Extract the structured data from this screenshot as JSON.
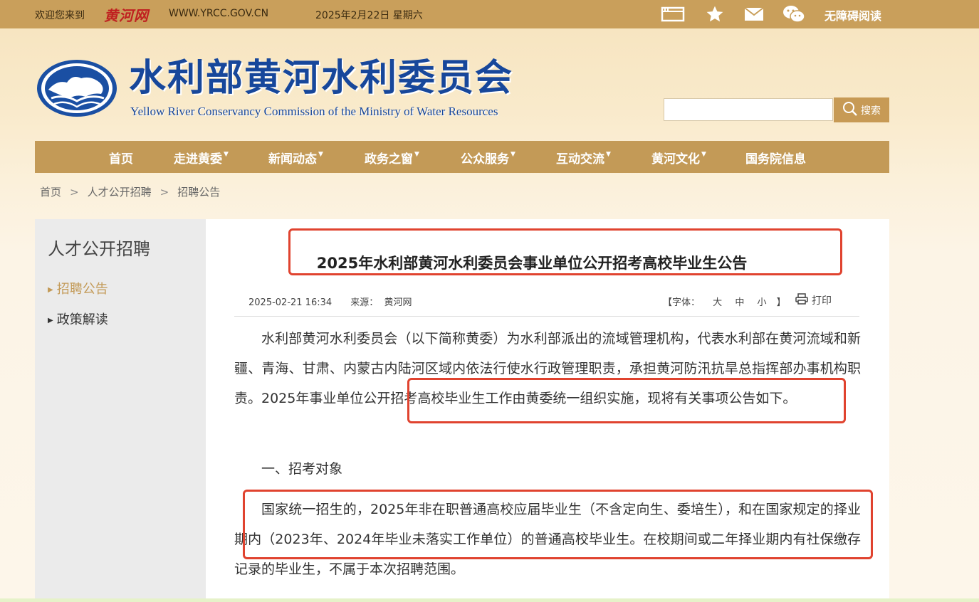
{
  "topbar": {
    "welcome": "欢迎您来到",
    "site_logo": "黄河网",
    "url": "WWW.YRCC.GOV.CN",
    "date": "2025年2月22日 星期六",
    "accessibility": "无障碍阅读",
    "icons": [
      "screen-icon",
      "star-icon",
      "mail-icon",
      "wechat-icon"
    ]
  },
  "header": {
    "title_cn": "水利部黄河水利委员会",
    "title_en": "Yellow River Conservancy Commission of the Ministry of Water Resources",
    "search": {
      "placeholder": "",
      "button_label": "搜索"
    }
  },
  "nav": {
    "items": [
      {
        "label": "首页",
        "dropdown": false
      },
      {
        "label": "走进黄委",
        "dropdown": true
      },
      {
        "label": "新闻动态",
        "dropdown": true
      },
      {
        "label": "政务之窗",
        "dropdown": true
      },
      {
        "label": "公众服务",
        "dropdown": true
      },
      {
        "label": "互动交流",
        "dropdown": true
      },
      {
        "label": "黄河文化",
        "dropdown": true
      },
      {
        "label": "国务院信息",
        "dropdown": false
      }
    ]
  },
  "breadcrumb": [
    "首页",
    "人才公开招聘",
    "招聘公告"
  ],
  "sidebar": {
    "title": "人才公开招聘",
    "items": [
      {
        "label": "招聘公告",
        "active": true
      },
      {
        "label": "政策解读",
        "active": false
      }
    ]
  },
  "article": {
    "title": "2025年水利部黄河水利委员会事业单位公开招考高校毕业生公告",
    "datetime": "2025-02-21 16:34",
    "source_label": "来源：",
    "source": "黄河网",
    "font_label": "【字体：",
    "font_large": "大",
    "font_medium": "中",
    "font_small": "小",
    "font_close": "】",
    "print_label": "打印",
    "paragraphs": [
      "水利部黄河水利委员会（以下简称黄委）为水利部派出的流域管理机构，代表水利部在黄河流域和新疆、青海、甘肃、内蒙古内陆河区域内依法行使水行政管理职责，承担黄河防汛抗旱总指挥部办事机构职责。2025年事业单位公开招考高校毕业生工作由黄委统一组织实施，现将有关事项公告如下。",
      "一、招考对象",
      "国家统一招生的，2025年非在职普通高校应届毕业生（不含定向生、委培生），和在国家规定的择业期内（2023年、2024年毕业未落实工作单位）的普通高校毕业生。在校期间或二年择业期内有社保缴存记录的毕业生，不属于本次招聘范围。"
    ]
  },
  "colors": {
    "topbar": "#c99f5b",
    "nav": "#c39a57",
    "title_blue": "#17479b",
    "highlight_red": "#e0432f",
    "sidebar_active": "#c39a57"
  }
}
